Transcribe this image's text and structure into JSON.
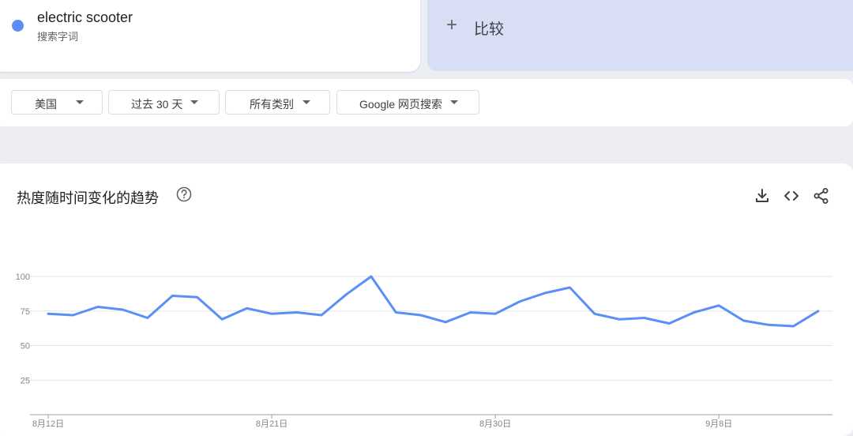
{
  "search_term": {
    "name": "electric scooter",
    "type_label": "搜索字词",
    "dot_color": "#5b8ef7"
  },
  "compare": {
    "icon": "plus-icon",
    "label": "比较"
  },
  "filters": [
    {
      "label": "美国"
    },
    {
      "label": "过去 30 天"
    },
    {
      "label": "所有类别"
    },
    {
      "label": "Google 网页搜索"
    }
  ],
  "chart_section": {
    "title": "热度随时间变化的趋势",
    "icons": [
      "help-icon",
      "download-icon",
      "embed-code-icon",
      "share-icon"
    ]
  },
  "chart_data": {
    "type": "line",
    "x": [
      "8月12日",
      "8月13日",
      "8月14日",
      "8月15日",
      "8月16日",
      "8月17日",
      "8月18日",
      "8月19日",
      "8月20日",
      "8月21日",
      "8月22日",
      "8月23日",
      "8月24日",
      "8月25日",
      "8月26日",
      "8月27日",
      "8月28日",
      "8月29日",
      "8月30日",
      "8月31日",
      "9月1日",
      "9月2日",
      "9月3日",
      "9月4日",
      "9月5日",
      "9月6日",
      "9月7日",
      "9月8日",
      "9月9日",
      "9月10日",
      "9月11日",
      "9月12日"
    ],
    "x_tick_labels": [
      "8月12日",
      "8月21日",
      "8月30日",
      "9月8日"
    ],
    "y_ticks": [
      25,
      50,
      75,
      100
    ],
    "ylim": [
      0,
      100
    ],
    "series": [
      {
        "name": "electric scooter",
        "color": "#5b8ef7",
        "values": [
          73,
          72,
          78,
          76,
          70,
          86,
          85,
          69,
          77,
          73,
          74,
          72,
          87,
          100,
          74,
          72,
          67,
          74,
          73,
          82,
          88,
          92,
          73,
          69,
          70,
          66,
          74,
          79,
          68,
          65,
          64,
          75
        ]
      }
    ],
    "grid": true
  }
}
